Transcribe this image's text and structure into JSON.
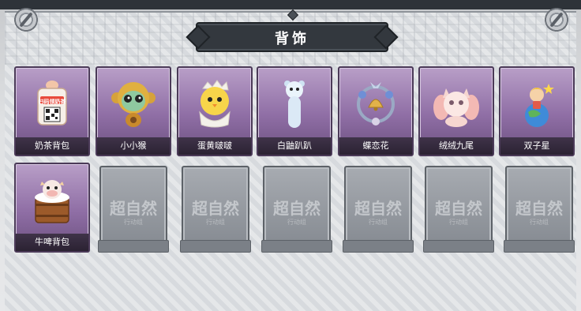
{
  "title": "背饰",
  "items": [
    {
      "label": "奶茶背包",
      "icon": "milk-tea-backpack-icon",
      "sticker": "扫码领奶茶"
    },
    {
      "label": "小小猴",
      "icon": "little-monkey-icon"
    },
    {
      "label": "蛋黄啵啵",
      "icon": "egg-chick-icon"
    },
    {
      "label": "白鼬趴趴",
      "icon": "white-ferret-icon"
    },
    {
      "label": "蝶恋花",
      "icon": "butterfly-flower-bell-icon"
    },
    {
      "label": "绒绒九尾",
      "icon": "nine-tail-fox-icon"
    },
    {
      "label": "双子星",
      "icon": "twin-star-planet-icon"
    },
    {
      "label": "牛啤背包",
      "icon": "beer-cow-backpack-icon"
    }
  ],
  "empty_slots": [
    {
      "watermark": "超自然",
      "sub": "行动组"
    },
    {
      "watermark": "超自然",
      "sub": "行动组"
    },
    {
      "watermark": "超自然",
      "sub": "行动组"
    },
    {
      "watermark": "超自然",
      "sub": "行动组"
    },
    {
      "watermark": "超自然",
      "sub": "行动组"
    },
    {
      "watermark": "超自然",
      "sub": "行动组"
    }
  ],
  "colors": {
    "card_purple": "#8f6ea5",
    "slot_gray": "#858a91",
    "title_plate": "#33383e"
  }
}
